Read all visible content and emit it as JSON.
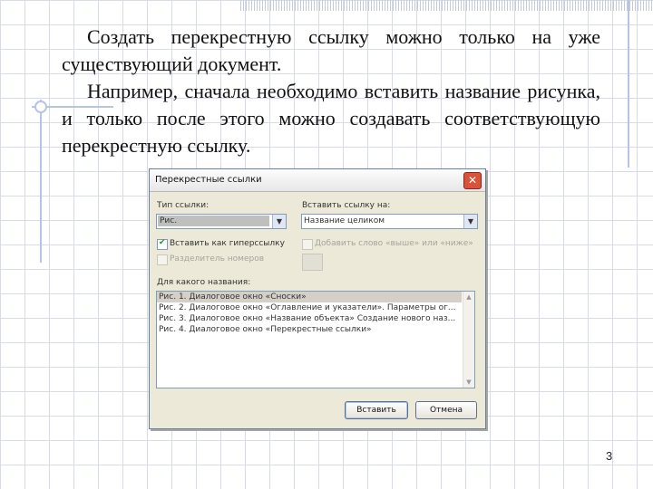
{
  "text": {
    "p1": "Создать перекрестную ссылку можно только на  уже существующий документ.",
    "p2": "Например, сначала необходимо вставить название рисунка, и только после этого можно создавать соответствующую перекрестную ссылку."
  },
  "dialog": {
    "title": "Перекрестные ссылки",
    "close_icon": "close-icon",
    "type_label": "Тип ссылки:",
    "type_value": "Рис.",
    "insert_label": "Вставить ссылку на:",
    "insert_value": "Название целиком",
    "hyperlink_label": "Вставить как гиперссылку",
    "hyperlink_checked": true,
    "above_below_label": "Добавить слово «выше» или «ниже»",
    "separate_numbers_label": "Разделитель номеров",
    "for_which_label": "Для какого названия:",
    "items": [
      "Рис. 1. Диалоговое окно «Сноски»",
      "Рис. 2. Диалоговое окно «Оглавление и указатели». Параметры ог...",
      "Рис. 3. Диалоговое окно «Название объекта» Создание нового наз...",
      "Рис. 4. Диалоговое окно «Перекрестные ссылки»"
    ],
    "insert_button": "Вставить",
    "cancel_button": "Отмена"
  },
  "page_number": "3"
}
